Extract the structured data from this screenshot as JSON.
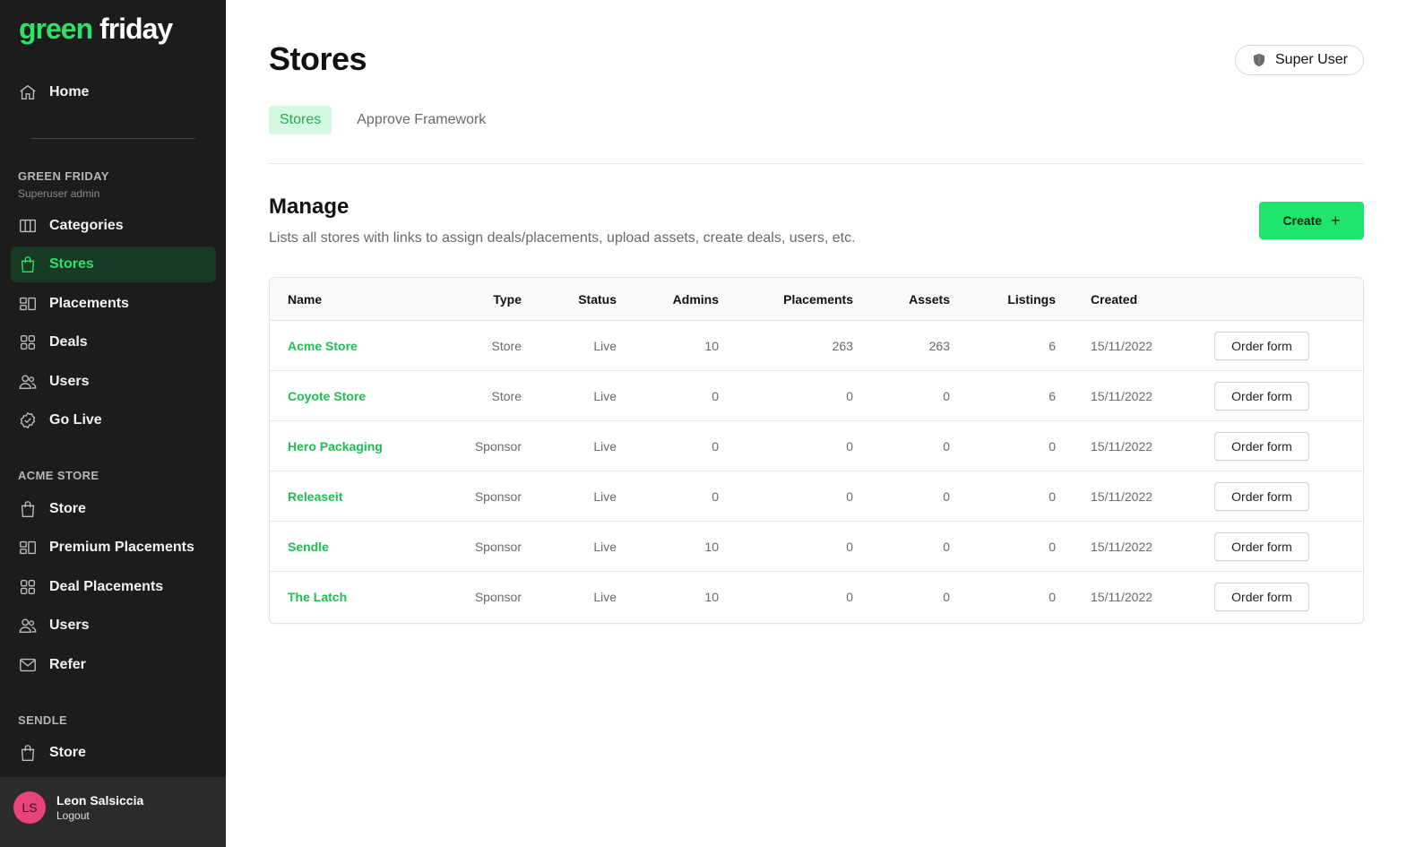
{
  "logo": {
    "part1": "green",
    "part2": "friday"
  },
  "sidebar": {
    "home": {
      "label": "Home",
      "icon": "home-icon"
    },
    "sections": [
      {
        "title": "GREEN FRIDAY",
        "subtitle": "Superuser admin",
        "items": [
          {
            "label": "Categories",
            "icon": "columns-icon"
          },
          {
            "label": "Stores",
            "icon": "shopping-bag-icon",
            "active": true
          },
          {
            "label": "Placements",
            "icon": "placements-icon"
          },
          {
            "label": "Deals",
            "icon": "grid-icon"
          },
          {
            "label": "Users",
            "icon": "users-icon"
          },
          {
            "label": "Go Live",
            "icon": "badge-check-icon"
          }
        ]
      },
      {
        "title": "ACME STORE",
        "items": [
          {
            "label": "Store",
            "icon": "shopping-bag-icon"
          },
          {
            "label": "Premium Placements",
            "icon": "placements-icon"
          },
          {
            "label": "Deal Placements",
            "icon": "grid-icon"
          },
          {
            "label": "Users",
            "icon": "users-icon"
          },
          {
            "label": "Refer",
            "icon": "mail-icon"
          }
        ]
      },
      {
        "title": "SENDLE",
        "items": [
          {
            "label": "Store",
            "icon": "shopping-bag-icon"
          }
        ]
      }
    ],
    "user": {
      "initials": "LS",
      "name": "Leon Salsiccia",
      "logout": "Logout"
    }
  },
  "header": {
    "title": "Stores",
    "role": "Super User"
  },
  "tabs": [
    {
      "label": "Stores",
      "active": true
    },
    {
      "label": "Approve Framework",
      "active": false
    }
  ],
  "manage": {
    "title": "Manage",
    "description": "Lists all stores with links to assign deals/placements, upload assets, create deals, users, etc.",
    "create_label": "Create",
    "create_icon": "plus-icon"
  },
  "table": {
    "columns": [
      "Name",
      "Type",
      "Status",
      "Admins",
      "Placements",
      "Assets",
      "Listings",
      "Created"
    ],
    "action_label": "Order form",
    "rows": [
      {
        "name": "Acme Store",
        "type": "Store",
        "status": "Live",
        "admins": "10",
        "placements": "263",
        "assets": "263",
        "listings": "6",
        "created": "15/11/2022"
      },
      {
        "name": "Coyote Store",
        "type": "Store",
        "status": "Live",
        "admins": "0",
        "placements": "0",
        "assets": "0",
        "listings": "6",
        "created": "15/11/2022"
      },
      {
        "name": "Hero Packaging",
        "type": "Sponsor",
        "status": "Live",
        "admins": "0",
        "placements": "0",
        "assets": "0",
        "listings": "0",
        "created": "15/11/2022"
      },
      {
        "name": "Releaseit",
        "type": "Sponsor",
        "status": "Live",
        "admins": "0",
        "placements": "0",
        "assets": "0",
        "listings": "0",
        "created": "15/11/2022"
      },
      {
        "name": "Sendle",
        "type": "Sponsor",
        "status": "Live",
        "admins": "10",
        "placements": "0",
        "assets": "0",
        "listings": "0",
        "created": "15/11/2022"
      },
      {
        "name": "The Latch",
        "type": "Sponsor",
        "status": "Live",
        "admins": "10",
        "placements": "0",
        "assets": "0",
        "listings": "0",
        "created": "15/11/2022"
      }
    ]
  },
  "colors": {
    "brand_green": "#2fe069",
    "link_green": "#1fbf52",
    "sidebar_bg": "#1c1c1c",
    "active_tab_bg": "#d4f8e0",
    "create_button": "#1fe56a",
    "avatar": "#e8447a"
  }
}
